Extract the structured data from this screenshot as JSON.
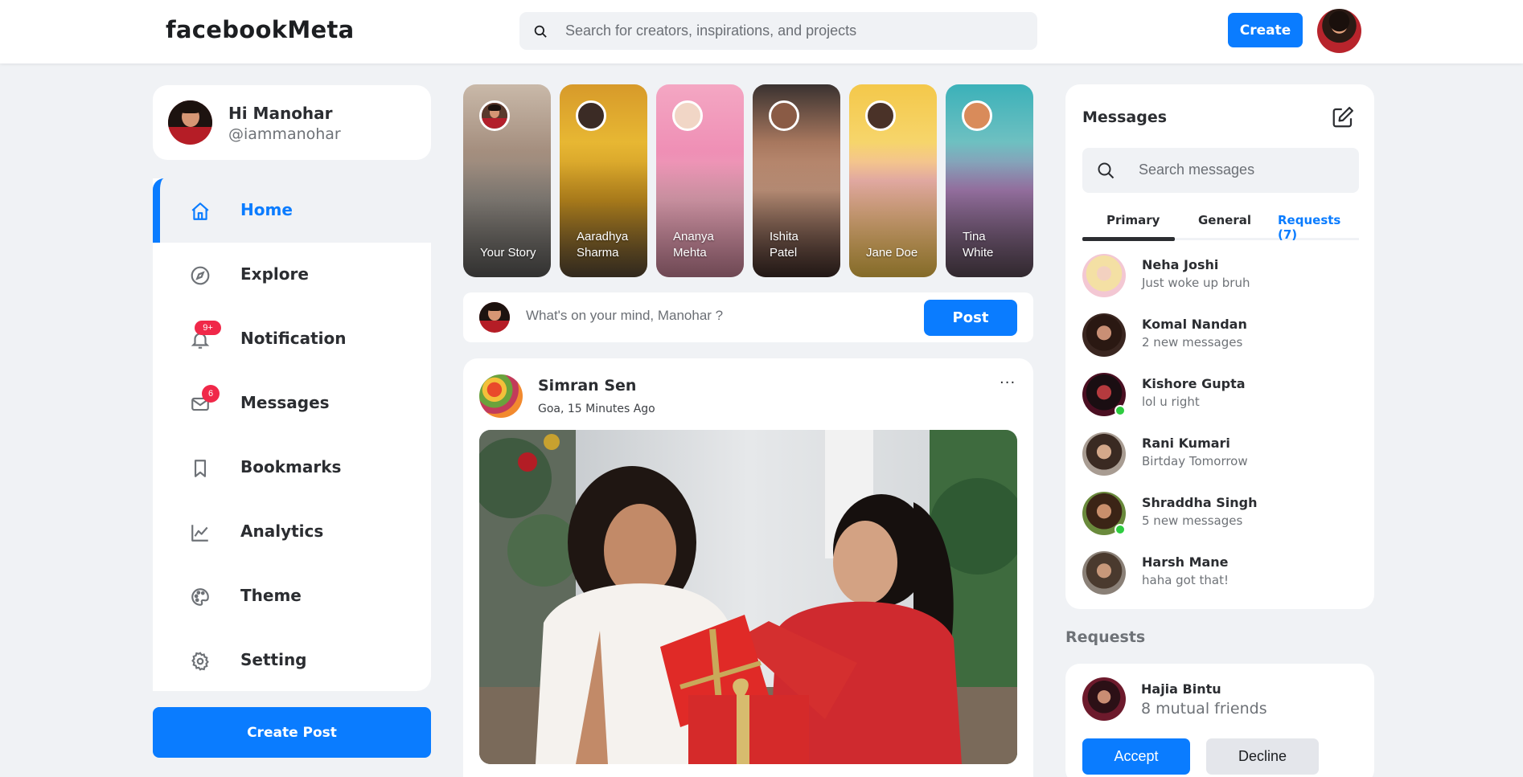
{
  "app": {
    "logo": "facebookMeta"
  },
  "search": {
    "placeholder": "Search for creators, inspirations, and projects"
  },
  "header": {
    "create_label": "Create"
  },
  "profile": {
    "greeting": "Hi Manohar",
    "handle": "@iammanohar"
  },
  "sidebar": {
    "items": [
      {
        "label": "Home",
        "icon": "home-icon",
        "active": true
      },
      {
        "label": "Explore",
        "icon": "compass-icon"
      },
      {
        "label": "Notification",
        "icon": "bell-icon",
        "badge": "9+"
      },
      {
        "label": "Messages",
        "icon": "mail-icon",
        "badge": "6"
      },
      {
        "label": "Bookmarks",
        "icon": "bookmark-icon"
      },
      {
        "label": "Analytics",
        "icon": "chart-line-icon"
      },
      {
        "label": "Theme",
        "icon": "palette-icon"
      },
      {
        "label": "Setting",
        "icon": "gear-icon"
      }
    ],
    "create_post_label": "Create Post"
  },
  "stories": [
    {
      "line1": "Your Story",
      "line2": ""
    },
    {
      "line1": "Aaradhya",
      "line2": "Sharma"
    },
    {
      "line1": "Ananya",
      "line2": "Mehta"
    },
    {
      "line1": "Ishita",
      "line2": "Patel"
    },
    {
      "line1": "Jane Doe",
      "line2": ""
    },
    {
      "line1": "Tina",
      "line2": "White"
    }
  ],
  "composer": {
    "placeholder": "What's on your mind, Manohar ?",
    "post_label": "Post"
  },
  "feed": {
    "posts": [
      {
        "author": "Simran Sen",
        "meta": "Goa, 15 Minutes Ago",
        "more": "···"
      }
    ]
  },
  "messages": {
    "title": "Messages",
    "search_placeholder": "Search messages",
    "tabs": [
      "Primary",
      "General",
      "Requests (7)"
    ],
    "items": [
      {
        "name": "Neha Joshi",
        "text": "Just woke up bruh",
        "online": false
      },
      {
        "name": "Komal Nandan",
        "text": "2 new messages",
        "online": false
      },
      {
        "name": "Kishore Gupta",
        "text": "lol u right",
        "online": true
      },
      {
        "name": "Rani Kumari",
        "text": "Birtday Tomorrow",
        "online": false
      },
      {
        "name": "Shraddha Singh",
        "text": "5 new messages",
        "online": true
      },
      {
        "name": "Harsh Mane",
        "text": "haha got that!",
        "online": false
      }
    ]
  },
  "requests": {
    "heading": "Requests",
    "items": [
      {
        "name": "Hajia Bintu",
        "mutual": "8 mutual friends",
        "accept_label": "Accept",
        "decline_label": "Decline"
      }
    ]
  },
  "colors": {
    "accent": "#0a7cff",
    "badge": "#f02849",
    "online": "#2ecc40",
    "background": "#f0f2f5"
  }
}
